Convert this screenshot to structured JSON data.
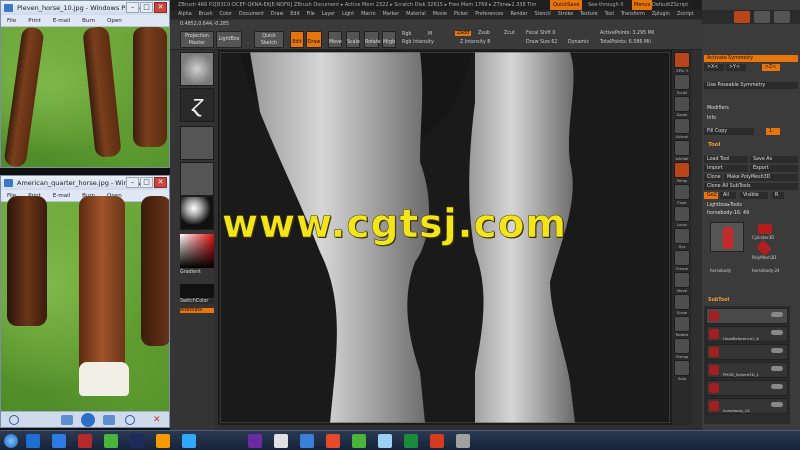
{
  "viewer1": {
    "title": "Pleven_horse_10.jpg - Windows Photo Vie...",
    "menu": [
      "File",
      "Print",
      "E-mail",
      "Burn",
      "Open"
    ]
  },
  "viewer2": {
    "title": "American_quarter_horse.jpg - Windows P...",
    "menu": [
      "File",
      "Print",
      "E-mail",
      "Burn",
      "Open"
    ]
  },
  "zbrush": {
    "title": "ZBrush 4R6 P2[B3C0-DCEF-QKNA-EKJE-NDFR]   ZBrush Document   ▸ Active Mem 2322 ▸ Scratch Disk 32615 ▸ Free Mem 1769 ▸ ZTime▸2.338 Tim",
    "title_right": [
      "QuickSave",
      "See-through 0",
      "Menus",
      "DefaultZScript"
    ],
    "menus": [
      "Alpha",
      "Brush",
      "Color",
      "Document",
      "Draw",
      "Edit",
      "File",
      "Layer",
      "Light",
      "Macro",
      "Marker",
      "Material",
      "Movie",
      "Picker",
      "Preferences",
      "Render",
      "Stencil",
      "Stroke",
      "Texture",
      "Tool",
      "Transform",
      "Zplugin",
      "Zscript"
    ],
    "coords": "0.4852,0.644,-0.285",
    "toolbar": {
      "projection_master": "Projection Master",
      "lightbox": "LightBox",
      "quick_sketch": "Quick Sketch",
      "edit": "Edit",
      "draw": "Draw",
      "move": "Move",
      "scale": "Scale",
      "rotate": "Rotate",
      "mrgb": "Mrgb",
      "rgb": "Rgb",
      "m": "M",
      "rgb_intensity": "Rgb Intensity",
      "zadd": "Zadd",
      "zsub": "Zsub",
      "zcut": "Zcut",
      "z_intensity": "Z Intensity 8",
      "focal_shift": "Focal Shift 0",
      "draw_size": "Draw Size 62",
      "dynamic": "Dynamic",
      "active_points": "ActivePoints: 3.295 Mil",
      "total_points": "TotalPoints: 6.586 Mil"
    },
    "left": {
      "gradient": "Gradient",
      "switch_color": "SwitchColor",
      "alternate": "Alternate"
    },
    "shelf": [
      "SPix 3",
      "Scroll",
      "Zoom",
      "Actual",
      "AAHalf",
      "Persp",
      "Floor",
      "Local",
      "Xyz",
      "Frame",
      "Move",
      "Scale",
      "Rotate",
      "Transp",
      "Solo"
    ],
    "right": {
      "activate_symmetry": "Activate Symmetry",
      "sym_x": ">X<",
      "sym_y": ">Y<",
      "sym_z": ">Z<",
      "use_poseable": "Use Poseable Symmetry",
      "modifiers": "Modifiers",
      "info": "Info",
      "fill_copy": "Fill Copy",
      "fill_value": "1",
      "tool_header": "Tool",
      "load_tool": "Load Tool",
      "save_as": "Save As",
      "import": "Import",
      "export": "Export",
      "clone": "Clone",
      "make_polymesh": "Make PolyMesh3D",
      "clone_all": "Clone All SubTools",
      "goz": "GoZ",
      "all": "All",
      "visible": "Visible",
      "r": "R",
      "lightbox_tools": "Lightbox▸Tools",
      "current_tool": "horsebody-16. 49",
      "tool_thumbs": [
        "Cylinder3D",
        "PolyMesh3D",
        "horsebody",
        "horsebody-24"
      ],
      "subtool_header": "SubTool",
      "subtools": [
        "",
        "HeadReference1_6",
        "",
        "PM3D_Sphere3D_1",
        "",
        "horsebody_24"
      ]
    }
  },
  "watermark": "www.cgtsj.com",
  "taskbar": {
    "colors": [
      "#1e6fd0",
      "#2c7be5",
      "#b52a2a",
      "#4ab53b",
      "#1e2b5a",
      "#f59a00",
      "#31a8ff",
      "#6a2ba0",
      "#e0e0e0",
      "#3b7fd9",
      "#e54b2a",
      "#4ab53b",
      "#9ad0f2",
      "#1b8a3d",
      "#d63b1f",
      "#a0a0a0"
    ]
  }
}
